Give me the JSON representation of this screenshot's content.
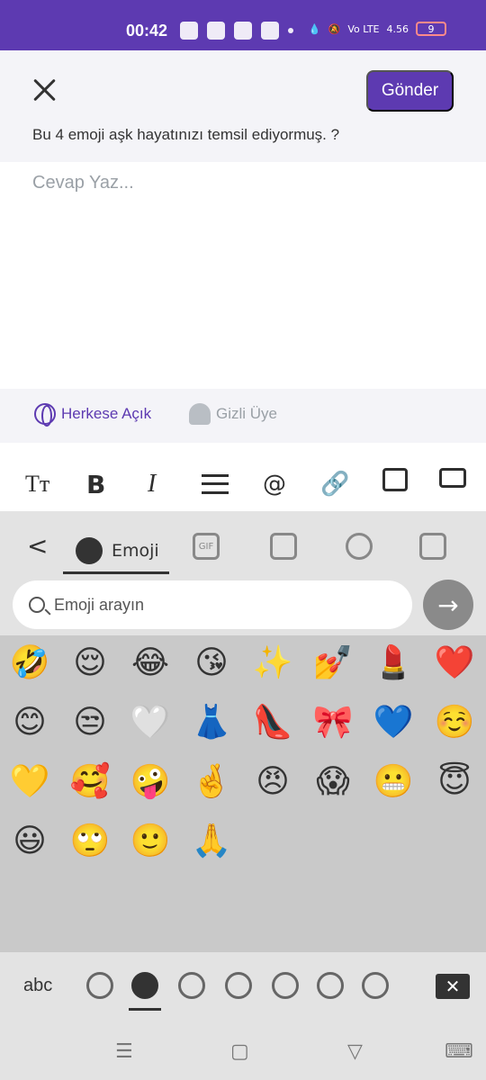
{
  "status_bar": {
    "time": "00:42",
    "battery": "9",
    "network": "Vo LTE",
    "speed": "4.56"
  },
  "header": {
    "send_label": "Gönder",
    "question": "Bu 4 emoji aşk hayatınızı temsil ediyormuş. ?"
  },
  "answer": {
    "placeholder": "Cevap Yaz..."
  },
  "privacy": {
    "public_label": "Herkese Açık",
    "hidden_label": "Gizli Üye"
  },
  "toolbar": {
    "text_size": "Tт",
    "bold": "B",
    "italic": "I",
    "at": "@",
    "link": "🔗"
  },
  "keyboard": {
    "back": "<",
    "emoji_tab": "Emoji",
    "gif_tab": "GIF",
    "search_placeholder": "Emoji arayın",
    "go_arrow": "→",
    "abc": "abc",
    "delete": "✕",
    "emojis": [
      "🤣",
      "😌",
      "😂",
      "😘",
      "✨",
      "💅",
      "💄",
      "❤️",
      "😊",
      "😒",
      "🤍",
      "👗",
      "👠",
      "🎀",
      "💙",
      "☺️",
      "💛",
      "🥰",
      "🤪",
      "🤞",
      "😠",
      "😱",
      "😬",
      "😇",
      "😃",
      "🙄",
      "🙂",
      "🙏"
    ]
  },
  "nav": {
    "menu": "☰",
    "home": "▢",
    "back": "▽",
    "keyboard": "⌨"
  }
}
